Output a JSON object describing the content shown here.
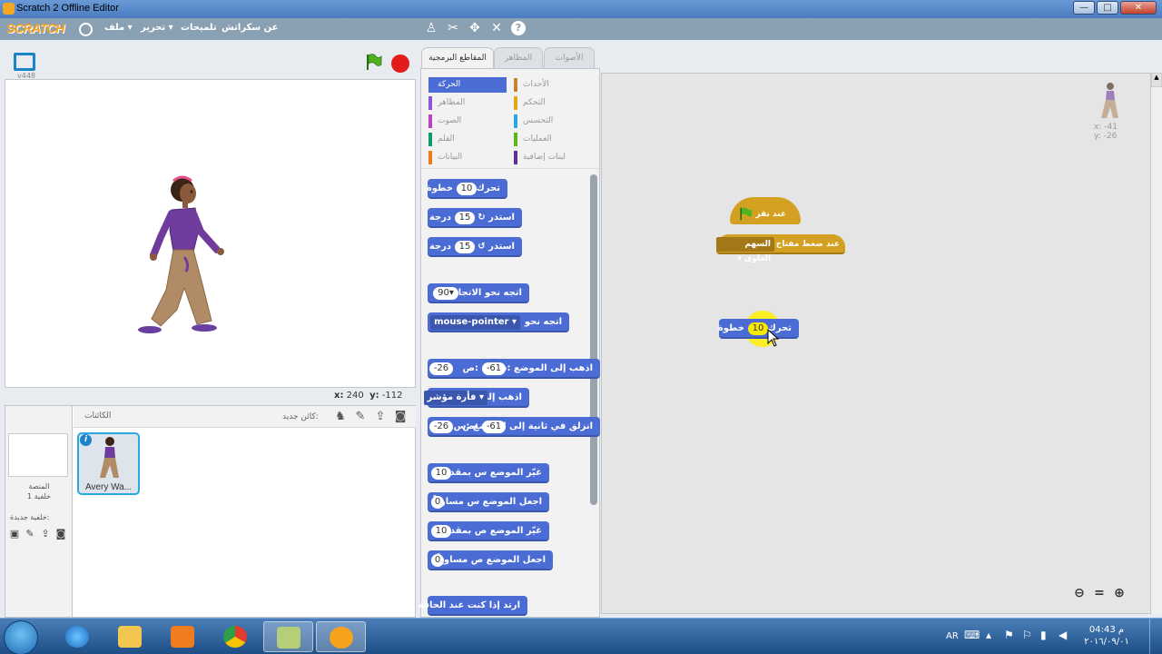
{
  "window": {
    "title": "Scratch 2 Offline Editor",
    "minimize": "—",
    "maximize": "□",
    "close": "✕"
  },
  "menubar": {
    "logo": "SCRATCH",
    "items": [
      "ملف ▾",
      "تحرير ▾",
      "تلميحات",
      "عن سكراتش"
    ]
  },
  "stage": {
    "version": "v448",
    "mouse_x_label": "x:",
    "mouse_x": "240",
    "mouse_y_label": "y:",
    "mouse_y": "-112"
  },
  "sprites": {
    "label": "الكائنات",
    "new_sprite_label": "كائن جديد:",
    "stage_name": "المنصة",
    "stage_backdrops": "خلفية 1",
    "new_backdrop": "خلفية جديدة:",
    "selected_sprite_name": "Avery Wa..."
  },
  "tabs": [
    "المقاطع البرمجية",
    "المظاهر",
    "الأصوات"
  ],
  "categories": [
    {
      "label": "الحركة",
      "color": "#4a6cd4",
      "selected": true
    },
    {
      "label": "المظاهر",
      "color": "#8a55d7"
    },
    {
      "label": "الصوت",
      "color": "#bb42c3"
    },
    {
      "label": "القلم",
      "color": "#0e9a6c"
    },
    {
      "label": "البيانات",
      "color": "#ee7d16"
    },
    {
      "label": "الأحداث",
      "color": "#c88330"
    },
    {
      "label": "التحكم",
      "color": "#e1a91a"
    },
    {
      "label": "التحسس",
      "color": "#2ca5e2"
    },
    {
      "label": "العمليات",
      "color": "#5cb712"
    },
    {
      "label": "لبنات إضافية",
      "color": "#632d99"
    }
  ],
  "palette_blocks": [
    {
      "text": "تحرك",
      "slot": "10",
      "suffix": "خطوة"
    },
    {
      "text": "استدر ↻",
      "slot": "15",
      "suffix": "درجة"
    },
    {
      "text": "استدر ↺",
      "slot": "15",
      "suffix": "درجة"
    },
    {
      "text": "اتجه نحو الاتجاه",
      "slot": "90▾"
    },
    {
      "text": "اتجه نحو",
      "dropdown": "mouse-pointer ▾"
    },
    {
      "text": "اذهب إلى الموضع :س",
      "slot": "-61",
      "suffix": ":ص",
      "slot2": "-26"
    },
    {
      "text": "اذهب إلى",
      "dropdown": "فأرة مؤشر ▾"
    },
    {
      "text": "انزلق في ثانية إلى الموضع :س",
      "slot": "-61",
      "suffix": ":ص",
      "slot2": "-26"
    },
    {
      "text": "غيّر الموضع س بمقدار",
      "slot": "10"
    },
    {
      "text": "اجعل الموضع س مساوياً",
      "slot": "0"
    },
    {
      "text": "غيّر الموضع ص بمقدار",
      "slot": "10"
    },
    {
      "text": "اجعل الموضع ص مساوياً",
      "slot": "0"
    },
    {
      "text": "ارتد إذا كنت عند الحافة"
    }
  ],
  "scripts": {
    "flag_hat_label": "عند نقر",
    "key_hat_label": "عند ضغط مفتاح",
    "key_dropdown": "السهم العلوي ▾",
    "move_block_text": "تحرك",
    "move_block_slot": "10",
    "move_block_suffix": "خطوة"
  },
  "sprite_info": {
    "x_label": "x:",
    "x": "-41",
    "y_label": "y:",
    "y": "-26"
  },
  "taskbar": {
    "lang": "AR",
    "time": "04:43 م",
    "date": "٢٠١٦/٠٩/٠١"
  }
}
